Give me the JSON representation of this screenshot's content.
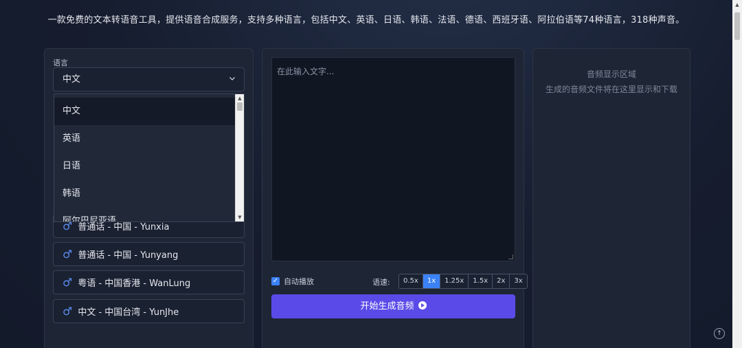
{
  "header": {
    "description": "一款免费的文本转语音工具，提供语音合成服务，支持多种语言，包括中文、英语、日语、韩语、法语、德语、西班牙语、阿拉伯语等74种语言，318种声音。"
  },
  "language": {
    "label": "语言",
    "selected": "中文",
    "options": [
      "中文",
      "英语",
      "日语",
      "韩语",
      "阿尔巴尼亚语"
    ]
  },
  "voices": [
    {
      "label": "普通话 - 中国 - Yunxia",
      "gender_icon": "male-icon"
    },
    {
      "label": "普通话 - 中国 - Yunyang",
      "gender_icon": "male-icon"
    },
    {
      "label": "粤语 - 中国香港 - WanLung",
      "gender_icon": "male-icon"
    },
    {
      "label": "中文 - 中国台湾 - YunJhe",
      "gender_icon": "male-icon"
    }
  ],
  "editor": {
    "placeholder": "在此输入文字..."
  },
  "controls": {
    "autoplay_label": "自动播放",
    "autoplay_checked": true,
    "speed_label": "语速:",
    "speeds": [
      "0.5x",
      "1x",
      "1.25x",
      "1.5x",
      "2x",
      "3x"
    ],
    "speed_selected": "1x",
    "generate_label": "开始生成音频"
  },
  "audio": {
    "title": "音频显示区域",
    "subtitle": "生成的音频文件将在这里显示和下载"
  },
  "colors": {
    "accent": "#3b82f6",
    "primary_button": "#5a4be8",
    "male_icon": "#5b8def"
  }
}
